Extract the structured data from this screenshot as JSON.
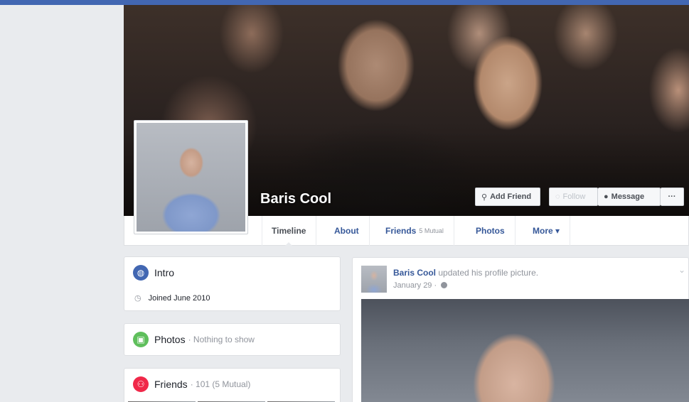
{
  "colors": {
    "brand": "#4267b2",
    "link": "#365899",
    "intro_icon": "#4267b2",
    "photos_icon": "#5fbf5c",
    "friends_icon": "#f02849"
  },
  "profile": {
    "name": "Baris Cool"
  },
  "actions": {
    "add_friend": "Add Friend",
    "follow": "Follow",
    "message": "Message",
    "more": "···"
  },
  "nav": {
    "timeline": "Timeline",
    "about": "About",
    "friends": "Friends",
    "friends_mutual": "5 Mutual",
    "photos": "Photos",
    "more": "More ▾"
  },
  "intro": {
    "title": "Intro",
    "joined": "Joined June 2010"
  },
  "photos_card": {
    "title": "Photos",
    "subtitle": "· Nothing to show"
  },
  "friends_card": {
    "title": "Friends",
    "subtitle": "· 101 (5 Mutual)"
  },
  "post": {
    "author": "Baris Cool",
    "action": " updated his profile picture.",
    "date": "January 29 ·"
  }
}
